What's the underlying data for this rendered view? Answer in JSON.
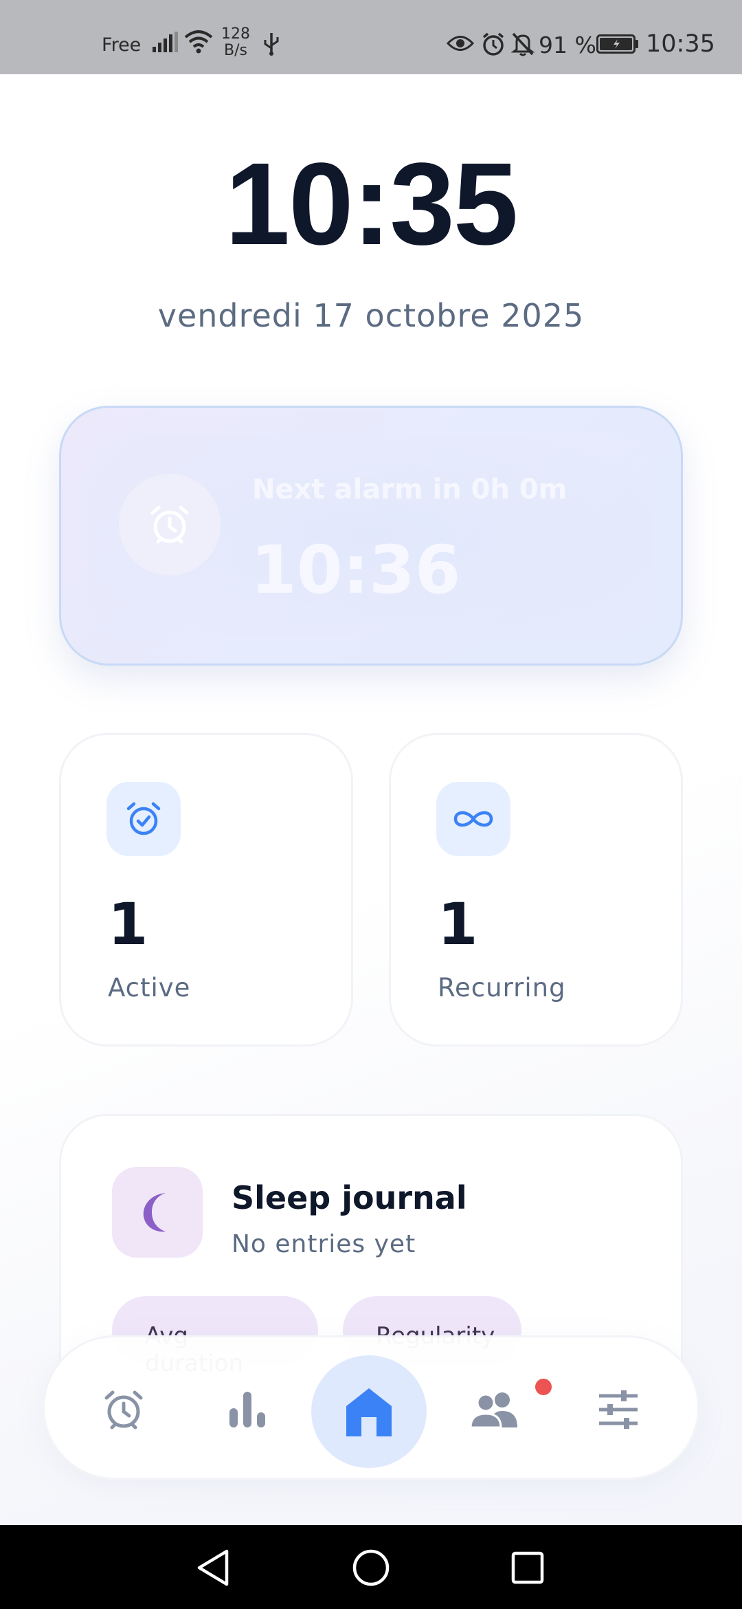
{
  "status_bar": {
    "carrier": "Free",
    "speed_value": "128",
    "speed_unit": "B/s",
    "battery_percent": "91 %",
    "time": "10:35"
  },
  "clock": {
    "time": "10:35",
    "date": "vendredi 17 octobre 2025"
  },
  "next_alarm": {
    "label": "Next alarm in 0h 0m",
    "time": "10:36"
  },
  "stats": {
    "active": {
      "value": "1",
      "label": "Active"
    },
    "recurring": {
      "value": "1",
      "label": "Recurring"
    }
  },
  "sleep_journal": {
    "title": "Sleep journal",
    "subtitle": "No entries yet",
    "chips": [
      "Avg duration",
      "Regularity"
    ]
  },
  "bottom_nav": {
    "items": [
      "alarm-clock-icon",
      "bar-chart-icon",
      "home-icon",
      "people-icon",
      "sliders-icon"
    ],
    "active": "home-icon",
    "notification_dot_color": "#ec5353"
  },
  "colors": {
    "primary_text": "#0f172a",
    "secondary_text": "#5b6b82",
    "accent_blue": "#3b82f6",
    "sleep_purple": "#8b5fc7"
  }
}
